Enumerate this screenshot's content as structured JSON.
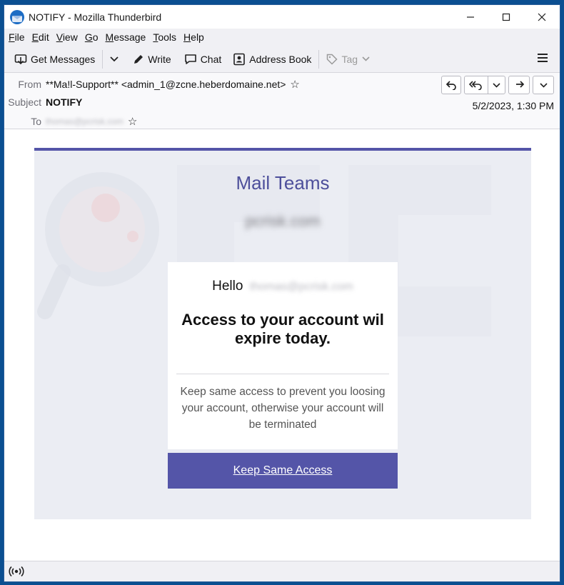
{
  "window": {
    "title": "NOTIFY - Mozilla Thunderbird",
    "controls": {
      "minimize": "–",
      "maximize": "☐",
      "close": "✕"
    }
  },
  "menubar": [
    {
      "label": "File",
      "mnemonic": "F",
      "rest": "ile"
    },
    {
      "label": "Edit",
      "mnemonic": "E",
      "rest": "dit"
    },
    {
      "label": "View",
      "mnemonic": "V",
      "rest": "iew"
    },
    {
      "label": "Go",
      "mnemonic": "G",
      "rest": "o"
    },
    {
      "label": "Message",
      "mnemonic": "M",
      "rest": "essage"
    },
    {
      "label": "Tools",
      "mnemonic": "T",
      "rest": "ools"
    },
    {
      "label": "Help",
      "mnemonic": "H",
      "rest": "elp"
    }
  ],
  "toolbar": {
    "get_messages": "Get Messages",
    "write": "Write",
    "chat": "Chat",
    "address_book": "Address Book",
    "tag": "Tag"
  },
  "header": {
    "from_label": "From",
    "from_value": "**Ma!l-Support** <admin_1@zcne.heberdomaine.net>",
    "subject_label": "Subject",
    "subject_value": "NOTIFY",
    "to_label": "To",
    "to_value": "thomas@pcrisk.com",
    "date": "5/2/2023, 1:30 PM"
  },
  "email": {
    "brand": "Mail Teams",
    "domain": "pcrisk.com",
    "greeting": "Hello",
    "greeting_email": "thomas@pcrisk.com",
    "headline": "Access to your account wil expire today.",
    "body": "Keep same access to prevent you loosing your account, otherwise your account will be terminated",
    "cta": "Keep Same  Access"
  },
  "colors": {
    "accent": "#5455a8",
    "brand_text": "#4d4f9b",
    "card_bg": "#ebedf3",
    "window_border": "#0b4f91"
  },
  "icons": {
    "app": "thunderbird-icon",
    "get_messages": "download-icon",
    "write": "pencil-icon",
    "chat": "chat-bubble-icon",
    "address_book": "address-book-icon",
    "tag": "tag-icon",
    "menu": "hamburger-icon",
    "status": "radio-wave-icon"
  }
}
